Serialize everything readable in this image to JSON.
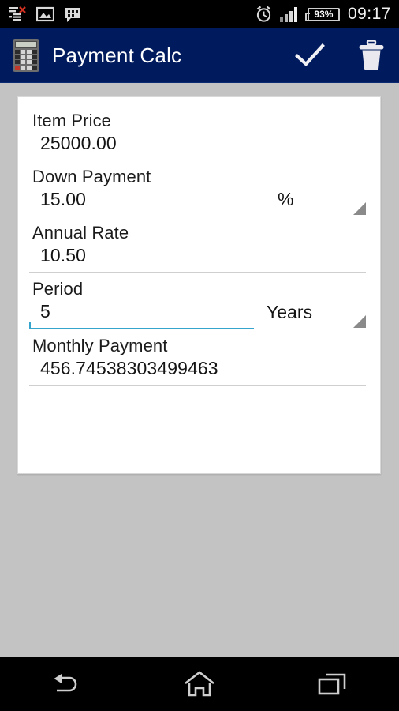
{
  "status_bar": {
    "left_icons": [
      {
        "name": "task-error-icon",
        "label": "list with red x"
      },
      {
        "name": "image-icon",
        "label": "photo"
      },
      {
        "name": "bbm-chat-icon",
        "label": "messenger"
      }
    ],
    "right_icons": [
      {
        "name": "alarm-clock-icon",
        "label": "alarm"
      },
      {
        "name": "signal-bars-icon",
        "label": "signal"
      }
    ],
    "battery_percent": "93%",
    "time": "09:17"
  },
  "action_bar": {
    "app_icon": "calculator-icon",
    "title": "Payment Calc",
    "actions": [
      {
        "name": "confirm-check-button",
        "icon": "check-icon"
      },
      {
        "name": "delete-button",
        "icon": "trash-icon"
      }
    ]
  },
  "form": {
    "fields": [
      {
        "label": "Item Price",
        "value": "25000.00",
        "focused": false,
        "unit": null
      },
      {
        "label": "Down Payment",
        "value": "15.00",
        "focused": false,
        "unit": "%"
      },
      {
        "label": "Annual Rate",
        "value": "10.50",
        "focused": false,
        "unit": null
      },
      {
        "label": "Period",
        "value": "5",
        "focused": true,
        "unit": "Years"
      },
      {
        "label": "Monthly Payment",
        "value": "456.74538303499463",
        "focused": false,
        "unit": null
      }
    ]
  },
  "nav_bar": {
    "buttons": [
      {
        "name": "nav-back-button",
        "icon": "back-arrow-icon"
      },
      {
        "name": "nav-home-button",
        "icon": "home-icon"
      },
      {
        "name": "nav-recents-button",
        "icon": "recents-icon"
      }
    ]
  },
  "colors": {
    "action_bar": "#001a5e",
    "page_background": "#c3c3c3",
    "card": "#ffffff",
    "focus_underline": "#36a5cd",
    "status_bar": "#000000"
  }
}
